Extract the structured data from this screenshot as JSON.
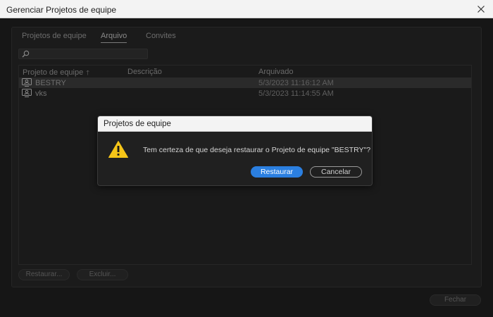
{
  "window": {
    "title": "Gerenciar Projetos de equipe",
    "close_icon": "close-icon"
  },
  "tabs": [
    {
      "label": "Projetos de equipe",
      "active": false
    },
    {
      "label": "Arquivo",
      "active": true
    },
    {
      "label": "Convites",
      "active": false
    }
  ],
  "search": {
    "placeholder": "",
    "value": "",
    "icon": "search-icon"
  },
  "table": {
    "columns": [
      "Projeto de equipe",
      "Descrição",
      "Arquivado"
    ],
    "sort_column": "Projeto de equipe",
    "sort_direction": "ascending",
    "rows": [
      {
        "name": "BESTRY",
        "description": "",
        "archived": "5/3/2023 11:16:12 AM",
        "selected": true
      },
      {
        "name": "vks",
        "description": "",
        "archived": "5/3/2023 11:14:55 AM",
        "selected": false
      }
    ]
  },
  "actions": {
    "restore_label": "Restaurar...",
    "delete_label": "Excluir...",
    "close_label": "Fechar"
  },
  "dialog": {
    "title": "Projetos de equipe",
    "message": "Tem certeza de que deseja restaurar o Projeto de equipe \"BESTRY\"?",
    "confirm_label": "Restaurar",
    "cancel_label": "Cancelar",
    "icon": "warning-icon"
  },
  "colors": {
    "accent": "#2b7fe0",
    "warning": "#f5c518"
  }
}
